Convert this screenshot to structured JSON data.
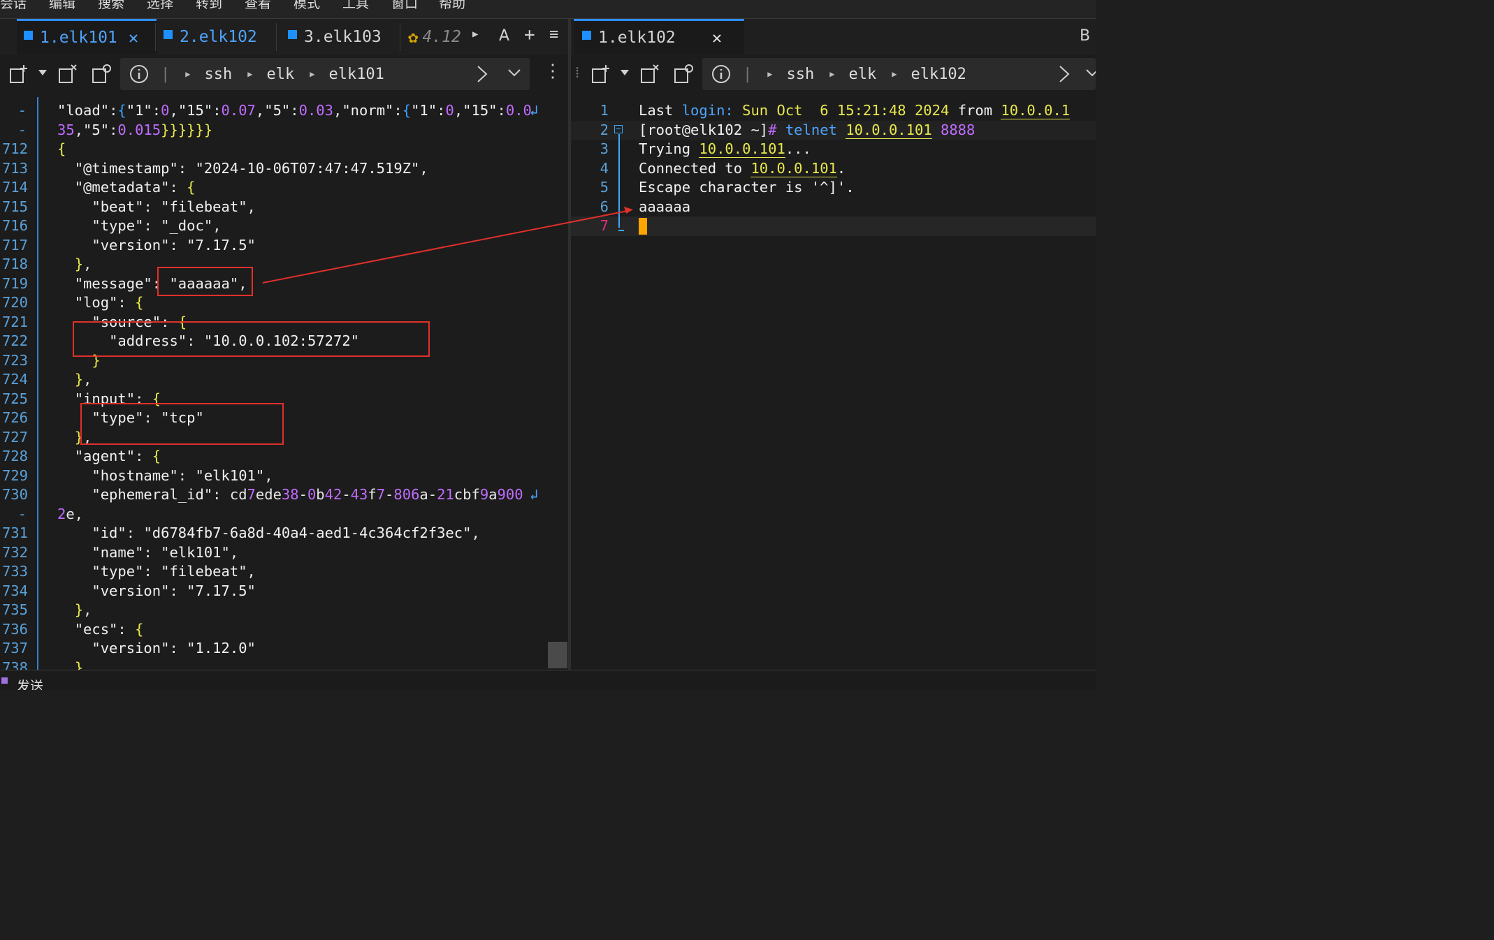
{
  "menu": [
    "会话",
    "编辑",
    "搜索",
    "选择",
    "转到",
    "查看",
    "模式",
    "工具",
    "窗口",
    "帮助"
  ],
  "left_pane": {
    "tabs": [
      {
        "label": "1.elk101",
        "active": true,
        "closable": true
      },
      {
        "label": "2.elk102",
        "active": false
      },
      {
        "label": "3.elk103",
        "active": false
      },
      {
        "label": "4.12",
        "active": false
      }
    ],
    "tab_actions": {
      "font": "A",
      "add": "+",
      "menu": "≡"
    },
    "breadcrumb": [
      "ssh",
      "elk",
      "elk101"
    ],
    "lines": [
      {
        "num": "-",
        "text": "\"load\":{\"1\":0,\"15\":0.07,\"5\":0.03,\"norm\":{\"1\":0,\"15\":0.0",
        "wrap": "↲"
      },
      {
        "num": "-",
        "text": "35,\"5\":0.015}}}}}}"
      },
      {
        "num": "712",
        "text": "{"
      },
      {
        "num": "713",
        "text": "  \"@timestamp\": \"2024-10-06T07:47:47.519Z\","
      },
      {
        "num": "714",
        "text": "  \"@metadata\": {"
      },
      {
        "num": "715",
        "text": "    \"beat\": \"filebeat\","
      },
      {
        "num": "716",
        "text": "    \"type\": \"_doc\","
      },
      {
        "num": "717",
        "text": "    \"version\": \"7.17.5\""
      },
      {
        "num": "718",
        "text": "  },"
      },
      {
        "num": "719",
        "text": "  \"message\": \"aaaaaa\","
      },
      {
        "num": "720",
        "text": "  \"log\": {"
      },
      {
        "num": "721",
        "text": "    \"source\": {"
      },
      {
        "num": "722",
        "text": "      \"address\": \"10.0.0.102:57272\""
      },
      {
        "num": "723",
        "text": "    }"
      },
      {
        "num": "724",
        "text": "  },"
      },
      {
        "num": "725",
        "text": "  \"input\": {"
      },
      {
        "num": "726",
        "text": "    \"type\": \"tcp\""
      },
      {
        "num": "727",
        "text": "  },"
      },
      {
        "num": "728",
        "text": "  \"agent\": {"
      },
      {
        "num": "729",
        "text": "    \"hostname\": \"elk101\","
      },
      {
        "num": "730",
        "text": "    \"ephemeral_id\": \"cd7ede38-0b42-43f7-806a-21cbf9a900",
        "wrap": "↲"
      },
      {
        "num": "-",
        "text": "2e\","
      },
      {
        "num": "731",
        "text": "    \"id\": \"d6784fb7-6a8d-40a4-aed1-4c364cf2f3ec\","
      },
      {
        "num": "732",
        "text": "    \"name\": \"elk101\","
      },
      {
        "num": "733",
        "text": "    \"type\": \"filebeat\","
      },
      {
        "num": "734",
        "text": "    \"version\": \"7.17.5\""
      },
      {
        "num": "735",
        "text": "  },"
      },
      {
        "num": "736",
        "text": "  \"ecs\": {"
      },
      {
        "num": "737",
        "text": "    \"version\": \"1.12.0\""
      },
      {
        "num": "738",
        "text": "  },"
      }
    ]
  },
  "right_pane": {
    "tabs": [
      {
        "label": "1.elk102",
        "active": true,
        "closable": true
      }
    ],
    "tab_actions": {
      "font": "B"
    },
    "breadcrumb": [
      "ssh",
      "elk",
      "elk102"
    ],
    "lines": [
      {
        "num": "1",
        "parts": [
          [
            "Last ",
            ""
          ],
          [
            "login:",
            "blue"
          ],
          [
            " Sun Oct  6 15:21:48 2024 ",
            "yel"
          ],
          [
            "from ",
            ""
          ],
          [
            "10.0.0.1",
            "yel ul"
          ]
        ]
      },
      {
        "num": "2",
        "parts": [
          [
            "[root@elk102 ~]",
            ""
          ],
          [
            "# ",
            "pur"
          ],
          [
            "telnet ",
            "blue"
          ],
          [
            "10.0.0.101",
            "yel ul"
          ],
          [
            " ",
            ""
          ],
          [
            "8888",
            "pur"
          ]
        ]
      },
      {
        "num": "3",
        "parts": [
          [
            "Trying ",
            ""
          ],
          [
            "10.0.0.101",
            "yel ul"
          ],
          [
            "...",
            ""
          ]
        ]
      },
      {
        "num": "4",
        "parts": [
          [
            "Connected to ",
            ""
          ],
          [
            "10.0.0.101",
            "yel ul"
          ],
          [
            ".",
            ""
          ]
        ]
      },
      {
        "num": "5",
        "parts": [
          [
            "Escape character is '^]'.",
            ""
          ]
        ]
      },
      {
        "num": "6",
        "parts": [
          [
            "aaaaaa",
            ""
          ]
        ]
      },
      {
        "num": "7",
        "parts": []
      }
    ]
  },
  "statusbar": {
    "label": "发送"
  },
  "colors": {
    "accent": "#2f8cff",
    "annotation": "#e0302a",
    "cursor": "#ffa500"
  }
}
